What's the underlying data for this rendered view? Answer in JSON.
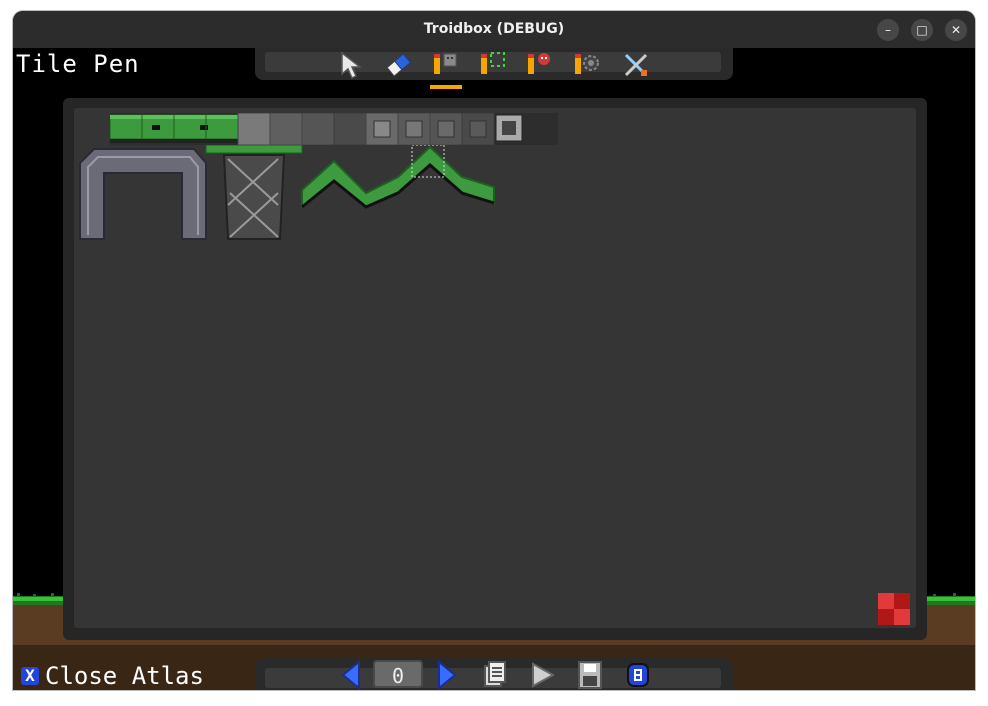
{
  "window": {
    "title": "Troidbox (DEBUG)",
    "minimize_glyph": "–",
    "maximize_glyph": "□",
    "close_glyph": "✕"
  },
  "editor": {
    "mode_label": "Tile Pen",
    "close_atlas_label": "Close Atlas",
    "close_atlas_glyph": "X",
    "page_number": "0"
  },
  "toolbar": {
    "tools": [
      "select-arrow-icon",
      "eraser-icon",
      "tile-pen-icon",
      "tile-select-pen-icon",
      "entity-pen-icon",
      "settings-pen-icon",
      "tools-icon"
    ],
    "active_tool": "tile-pen-icon"
  },
  "bottombar": {
    "items": [
      "prev-page-icon",
      "page-number-field",
      "next-page-icon",
      "clipboard-icon",
      "play-icon",
      "save-icon",
      "b-icon"
    ]
  },
  "colors": {
    "accent": "#f7a600",
    "grass": "#2ea82e",
    "dirt": "#5a3c22",
    "tile_green": "#3e9a3e",
    "tile_gray": "#6b6b6b",
    "blue_button": "#2346d8",
    "red_block": "#d02020"
  }
}
